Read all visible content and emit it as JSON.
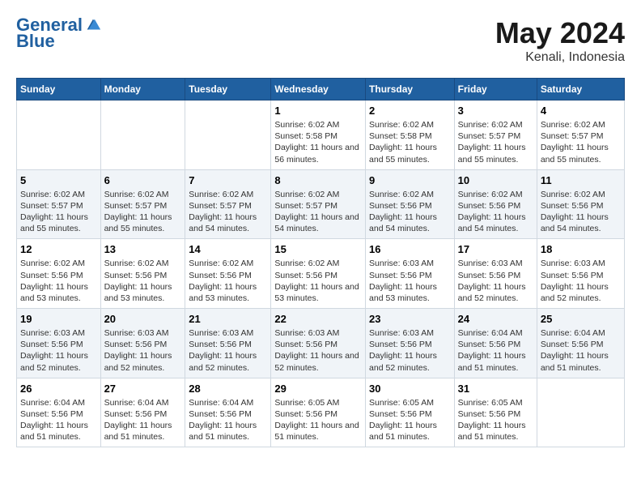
{
  "header": {
    "logo_general": "General",
    "logo_blue": "Blue",
    "main_title": "May 2024",
    "subtitle": "Kenali, Indonesia"
  },
  "weekdays": [
    "Sunday",
    "Monday",
    "Tuesday",
    "Wednesday",
    "Thursday",
    "Friday",
    "Saturday"
  ],
  "weeks": [
    [
      {
        "day": "",
        "sunrise": "",
        "sunset": "",
        "daylight": ""
      },
      {
        "day": "",
        "sunrise": "",
        "sunset": "",
        "daylight": ""
      },
      {
        "day": "",
        "sunrise": "",
        "sunset": "",
        "daylight": ""
      },
      {
        "day": "1",
        "sunrise": "6:02 AM",
        "sunset": "5:58 PM",
        "daylight": "11 hours and 56 minutes."
      },
      {
        "day": "2",
        "sunrise": "6:02 AM",
        "sunset": "5:58 PM",
        "daylight": "11 hours and 55 minutes."
      },
      {
        "day": "3",
        "sunrise": "6:02 AM",
        "sunset": "5:57 PM",
        "daylight": "11 hours and 55 minutes."
      },
      {
        "day": "4",
        "sunrise": "6:02 AM",
        "sunset": "5:57 PM",
        "daylight": "11 hours and 55 minutes."
      }
    ],
    [
      {
        "day": "5",
        "sunrise": "6:02 AM",
        "sunset": "5:57 PM",
        "daylight": "11 hours and 55 minutes."
      },
      {
        "day": "6",
        "sunrise": "6:02 AM",
        "sunset": "5:57 PM",
        "daylight": "11 hours and 55 minutes."
      },
      {
        "day": "7",
        "sunrise": "6:02 AM",
        "sunset": "5:57 PM",
        "daylight": "11 hours and 54 minutes."
      },
      {
        "day": "8",
        "sunrise": "6:02 AM",
        "sunset": "5:57 PM",
        "daylight": "11 hours and 54 minutes."
      },
      {
        "day": "9",
        "sunrise": "6:02 AM",
        "sunset": "5:56 PM",
        "daylight": "11 hours and 54 minutes."
      },
      {
        "day": "10",
        "sunrise": "6:02 AM",
        "sunset": "5:56 PM",
        "daylight": "11 hours and 54 minutes."
      },
      {
        "day": "11",
        "sunrise": "6:02 AM",
        "sunset": "5:56 PM",
        "daylight": "11 hours and 54 minutes."
      }
    ],
    [
      {
        "day": "12",
        "sunrise": "6:02 AM",
        "sunset": "5:56 PM",
        "daylight": "11 hours and 53 minutes."
      },
      {
        "day": "13",
        "sunrise": "6:02 AM",
        "sunset": "5:56 PM",
        "daylight": "11 hours and 53 minutes."
      },
      {
        "day": "14",
        "sunrise": "6:02 AM",
        "sunset": "5:56 PM",
        "daylight": "11 hours and 53 minutes."
      },
      {
        "day": "15",
        "sunrise": "6:02 AM",
        "sunset": "5:56 PM",
        "daylight": "11 hours and 53 minutes."
      },
      {
        "day": "16",
        "sunrise": "6:03 AM",
        "sunset": "5:56 PM",
        "daylight": "11 hours and 53 minutes."
      },
      {
        "day": "17",
        "sunrise": "6:03 AM",
        "sunset": "5:56 PM",
        "daylight": "11 hours and 52 minutes."
      },
      {
        "day": "18",
        "sunrise": "6:03 AM",
        "sunset": "5:56 PM",
        "daylight": "11 hours and 52 minutes."
      }
    ],
    [
      {
        "day": "19",
        "sunrise": "6:03 AM",
        "sunset": "5:56 PM",
        "daylight": "11 hours and 52 minutes."
      },
      {
        "day": "20",
        "sunrise": "6:03 AM",
        "sunset": "5:56 PM",
        "daylight": "11 hours and 52 minutes."
      },
      {
        "day": "21",
        "sunrise": "6:03 AM",
        "sunset": "5:56 PM",
        "daylight": "11 hours and 52 minutes."
      },
      {
        "day": "22",
        "sunrise": "6:03 AM",
        "sunset": "5:56 PM",
        "daylight": "11 hours and 52 minutes."
      },
      {
        "day": "23",
        "sunrise": "6:03 AM",
        "sunset": "5:56 PM",
        "daylight": "11 hours and 52 minutes."
      },
      {
        "day": "24",
        "sunrise": "6:04 AM",
        "sunset": "5:56 PM",
        "daylight": "11 hours and 51 minutes."
      },
      {
        "day": "25",
        "sunrise": "6:04 AM",
        "sunset": "5:56 PM",
        "daylight": "11 hours and 51 minutes."
      }
    ],
    [
      {
        "day": "26",
        "sunrise": "6:04 AM",
        "sunset": "5:56 PM",
        "daylight": "11 hours and 51 minutes."
      },
      {
        "day": "27",
        "sunrise": "6:04 AM",
        "sunset": "5:56 PM",
        "daylight": "11 hours and 51 minutes."
      },
      {
        "day": "28",
        "sunrise": "6:04 AM",
        "sunset": "5:56 PM",
        "daylight": "11 hours and 51 minutes."
      },
      {
        "day": "29",
        "sunrise": "6:05 AM",
        "sunset": "5:56 PM",
        "daylight": "11 hours and 51 minutes."
      },
      {
        "day": "30",
        "sunrise": "6:05 AM",
        "sunset": "5:56 PM",
        "daylight": "11 hours and 51 minutes."
      },
      {
        "day": "31",
        "sunrise": "6:05 AM",
        "sunset": "5:56 PM",
        "daylight": "11 hours and 51 minutes."
      },
      {
        "day": "",
        "sunrise": "",
        "sunset": "",
        "daylight": ""
      }
    ]
  ]
}
